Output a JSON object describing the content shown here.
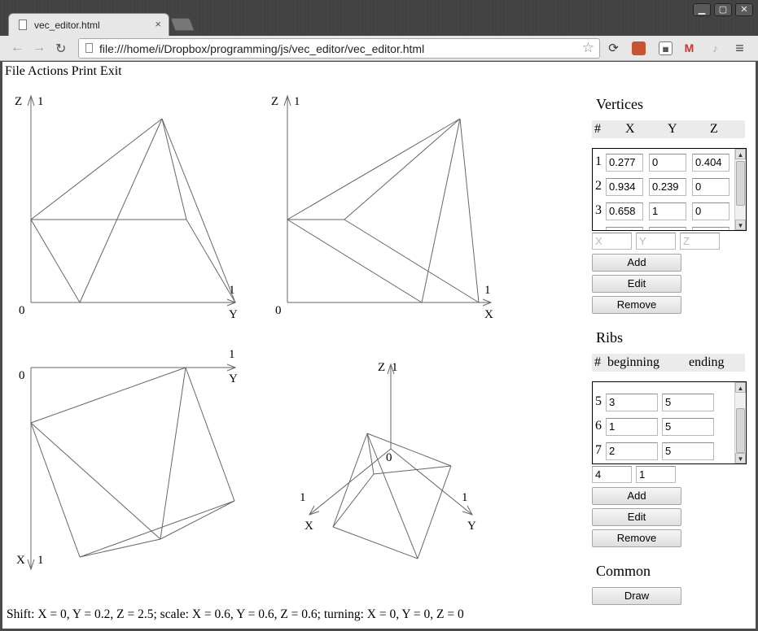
{
  "browser": {
    "tab_title": "vec_editor.html",
    "tab_close": "×",
    "url": "file:///home/i/Dropbox/programming/js/vec_editor/vec_editor.html",
    "window_buttons": {
      "minimize": "▁",
      "maximize": "▢",
      "close": "✕"
    },
    "nav": {
      "back": "←",
      "forward": "→",
      "reload": "↻",
      "star": "☆",
      "menu": "≡"
    },
    "extensions": [
      "sync-icon",
      "bookmark-icon",
      "qr-icon",
      "gmail-icon",
      "bell-icon"
    ]
  },
  "menu": {
    "file": "File",
    "actions": "Actions",
    "print": "Print",
    "exit": "Exit"
  },
  "views": {
    "top_left": {
      "v_axis": "Z",
      "v_max": "1",
      "h_axis": "Y",
      "h_max": "1",
      "origin": "0"
    },
    "top_right": {
      "v_axis": "Z",
      "v_max": "1",
      "h_axis": "X",
      "h_max": "1",
      "origin": "0"
    },
    "bottom_left": {
      "v_axis": "X",
      "v_max": "1",
      "h_axis": "Y",
      "h_max": "1",
      "origin": "0"
    },
    "bottom_right": {
      "z_axis": "Z",
      "z_max": "1",
      "x_axis": "X",
      "x_max": "1",
      "y_axis": "Y",
      "y_max": "1",
      "origin": "0"
    }
  },
  "status": "Shift: X = 0, Y = 0.2, Z = 2.5; scale: X = 0.6, Y = 0.6, Z = 0.6; turning: X = 0, Y = 0, Z = 0",
  "vertices": {
    "title": "Vertices",
    "headers": {
      "num": "#",
      "x": "X",
      "y": "Y",
      "z": "Z"
    },
    "rows": [
      {
        "num": "1",
        "x": "0.277",
        "y": "0",
        "z": "0.404"
      },
      {
        "num": "2",
        "x": "0.934",
        "y": "0.239",
        "z": "0"
      },
      {
        "num": "3",
        "x": "0.658",
        "y": "1",
        "z": "0"
      }
    ],
    "new_x_placeholder": "X",
    "new_y_placeholder": "Y",
    "new_z_placeholder": "Z",
    "add": "Add",
    "edit": "Edit",
    "remove": "Remove"
  },
  "ribs": {
    "title": "Ribs",
    "headers": {
      "num": "#",
      "beginning": "beginning",
      "ending": "ending"
    },
    "rows": [
      {
        "num": "5",
        "beginning": "3",
        "ending": "5"
      },
      {
        "num": "6",
        "beginning": "1",
        "ending": "5"
      },
      {
        "num": "7",
        "beginning": "2",
        "ending": "5"
      }
    ],
    "new_beginning": "4",
    "new_ending": "1",
    "add": "Add",
    "edit": "Edit",
    "remove": "Remove"
  },
  "common": {
    "title": "Common",
    "draw": "Draw"
  }
}
